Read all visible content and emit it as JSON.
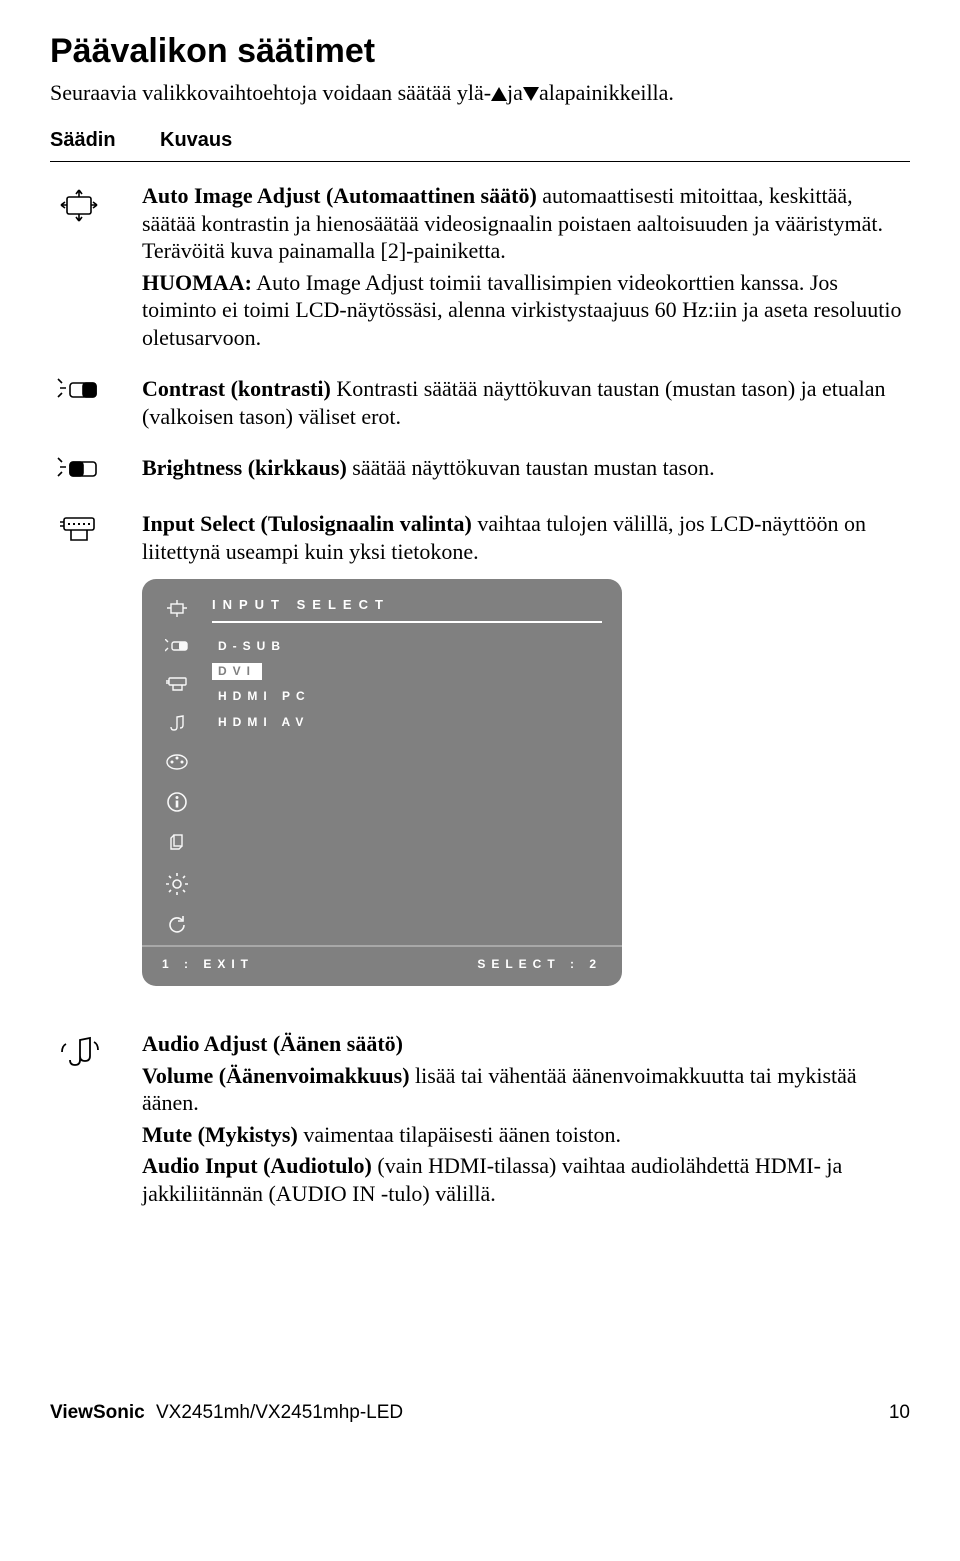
{
  "title": "Päävalikon säätimet",
  "intro_pre": "Seuraavia valikkovaihtoehtoja voidaan säätää ylä-",
  "intro_mid": "ja",
  "intro_post": "alapainikkeilla.",
  "headers": {
    "icon": "Säädin",
    "desc": "Kuvaus"
  },
  "items": {
    "auto": {
      "b1": "Auto Image Adjust (Automaattinen säätö)",
      "t1": " automaattisesti mitoittaa, keskittää, säätää kontrastin ja hienosäätää videosignaalin poistaen aaltoisuuden ja vääristymät. Terävöitä kuva painamalla [2]-painiketta.",
      "b2": "HUOMAA:",
      "t2": " Auto Image Adjust toimii tavallisimpien videokorttien kanssa. Jos toiminto ei toimi LCD-näytössäsi, alenna virkistystaajuus 60 Hz:iin ja aseta resoluutio oletusarvoon."
    },
    "contrast": {
      "b": "Contrast (kontrasti)",
      "t": " Kontrasti säätää näyttökuvan taustan (mustan tason) ja etualan (valkoisen tason) väliset erot."
    },
    "brightness": {
      "b": "Brightness (kirkkaus)",
      "t": " säätää näyttökuvan taustan mustan tason."
    },
    "input": {
      "b": "Input Select (Tulosignaalin valinta)",
      "t": " vaihtaa tulojen välillä,  jos LCD-näyttöön on liitettynä useampi kuin yksi tietokone."
    },
    "audio": {
      "b1": "Audio Adjust (Äänen säätö)",
      "b2": "Volume (Äänenvoimakkuus)",
      "t2": " lisää tai vähentää äänenvoimakkuutta tai mykistää äänen.",
      "b3": "Mute (Mykistys)",
      "t3": " vaimentaa tilapäisesti äänen toiston.",
      "b4": "Audio Input (Audiotulo)",
      "t4": " (vain HDMI-tilassa) vaihtaa audiolähdettä HDMI- ja jakkiliitännän (AUDIO IN -tulo) välillä."
    }
  },
  "osd": {
    "title": "INPUT SELECT",
    "opts": [
      "D-SUB",
      "DVI",
      "HDMI PC",
      "HDMI AV"
    ],
    "footer_left": "1 : EXIT",
    "footer_right": "SELECT : 2"
  },
  "footer": {
    "brand": "ViewSonic",
    "model": "VX2451mh/VX2451mhp-LED",
    "page": "10"
  }
}
